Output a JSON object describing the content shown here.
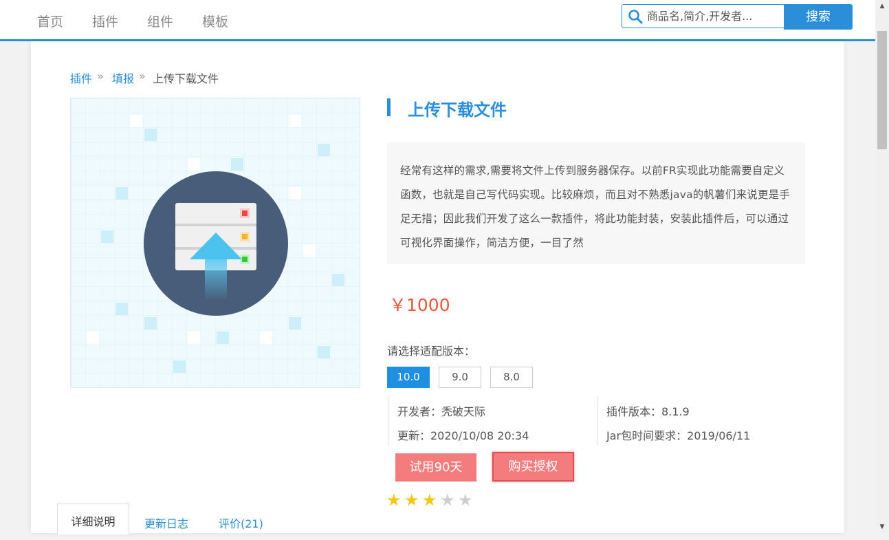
{
  "nav": {
    "items": [
      "首页",
      "插件",
      "组件",
      "模板"
    ]
  },
  "search": {
    "placeholder": "商品名,简介,开发者...",
    "button_label": "搜索"
  },
  "breadcrumb": {
    "items": [
      "插件",
      "填报"
    ],
    "separator": "»",
    "current": "上传下载文件"
  },
  "product": {
    "title": "上传下载文件",
    "description": "经常有这样的需求,需要将文件上传到服务器保存。以前FR实现此功能需要自定义函数，也就是自己写代码实现。比较麻烦，而且对不熟悉java的帆薯们来说更是手足无措；因此我们开发了这么一款插件，将此功能封装，安装此插件后，可以通过可视化界面操作，简洁方便，一目了然",
    "price": "￥1000",
    "version_label": "请选择适配版本：",
    "versions": [
      "10.0",
      "9.0",
      "8.0"
    ],
    "selected_version": "10.0",
    "developer": "开发者：秃破天际",
    "updated": "更新：2020/10/08 20:34",
    "plugin_version": "插件版本：8.1.9",
    "jar_requirement": "Jar包时间要求：2019/06/11",
    "trial_label": "试用90天",
    "buy_label": "购买授权",
    "rating": 3,
    "rating_max": 5
  },
  "tabs": {
    "details": "详细说明",
    "changelog": "更新日志",
    "reviews": "评价(21)"
  },
  "colors": {
    "accent": "#2a8fd8",
    "price": "#e8563e",
    "button": "#f47c7c",
    "star": "#f5c518"
  }
}
